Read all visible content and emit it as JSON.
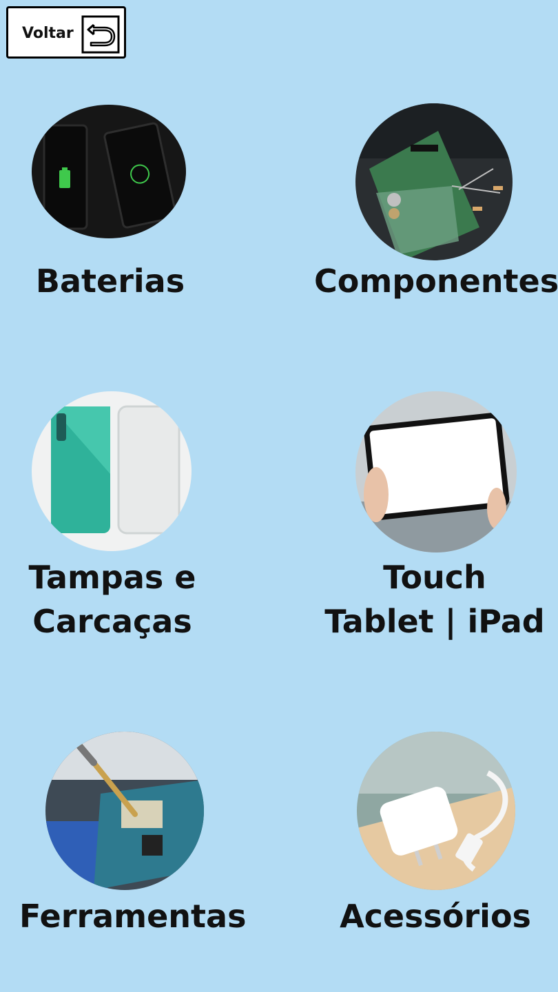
{
  "back_button": {
    "label": "Voltar",
    "icon": "return-arrow-icon"
  },
  "categories": [
    {
      "label_lines": [
        "Baterias"
      ],
      "icon": "battery-phones-image"
    },
    {
      "label_lines": [
        "Componentes"
      ],
      "icon": "circuit-board-image"
    },
    {
      "label_lines": [
        "Tampas e",
        "Carcaças"
      ],
      "icon": "phone-covers-image"
    },
    {
      "label_lines": [
        "Touch",
        "Tablet | iPad"
      ],
      "icon": "tablet-touch-image"
    },
    {
      "label_lines": [
        "Ferramentas"
      ],
      "icon": "soldering-tools-image"
    },
    {
      "label_lines": [
        "Acessórios"
      ],
      "icon": "charger-cable-image"
    }
  ],
  "colors": {
    "background": "#b3dcf4",
    "text": "#111111",
    "button_bg": "#ffffff"
  }
}
